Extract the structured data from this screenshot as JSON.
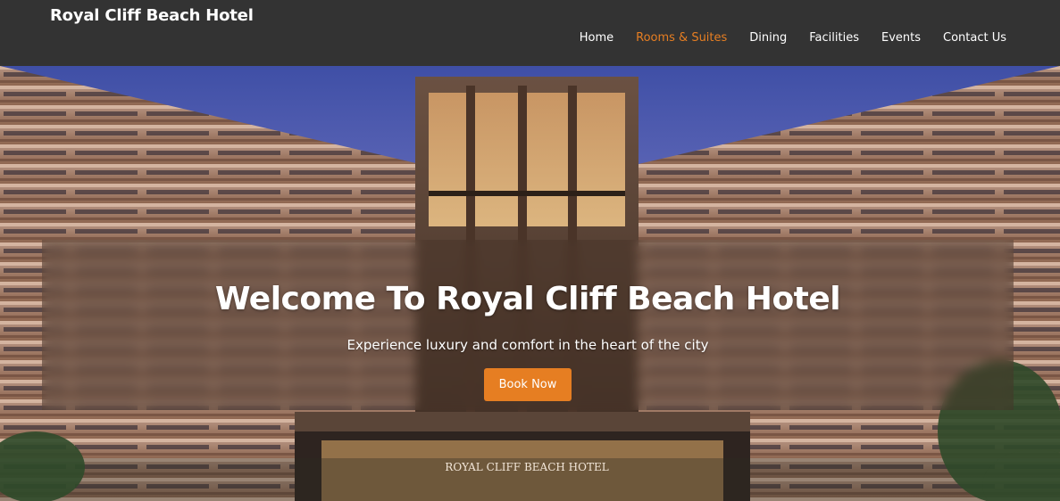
{
  "navbar": {
    "brand": "Royal Cliff Beach Hotel",
    "links": [
      {
        "label": "Home",
        "active": false
      },
      {
        "label": "Rooms & Suites",
        "active": true
      },
      {
        "label": "Dining",
        "active": false
      },
      {
        "label": "Facilities",
        "active": false
      },
      {
        "label": "Events",
        "active": false
      },
      {
        "label": "Contact Us",
        "active": false
      }
    ]
  },
  "hero": {
    "title": "Welcome To Royal Cliff Beach Hotel",
    "subtitle": "Experience luxury and comfort in the heart of the city",
    "button_label": "Book Now",
    "sign_text": "ROYAL CLIFF BEACH HOTEL"
  },
  "colors": {
    "navbar_bg": "#333333",
    "accent": "#e67e22",
    "text": "#ffffff"
  }
}
